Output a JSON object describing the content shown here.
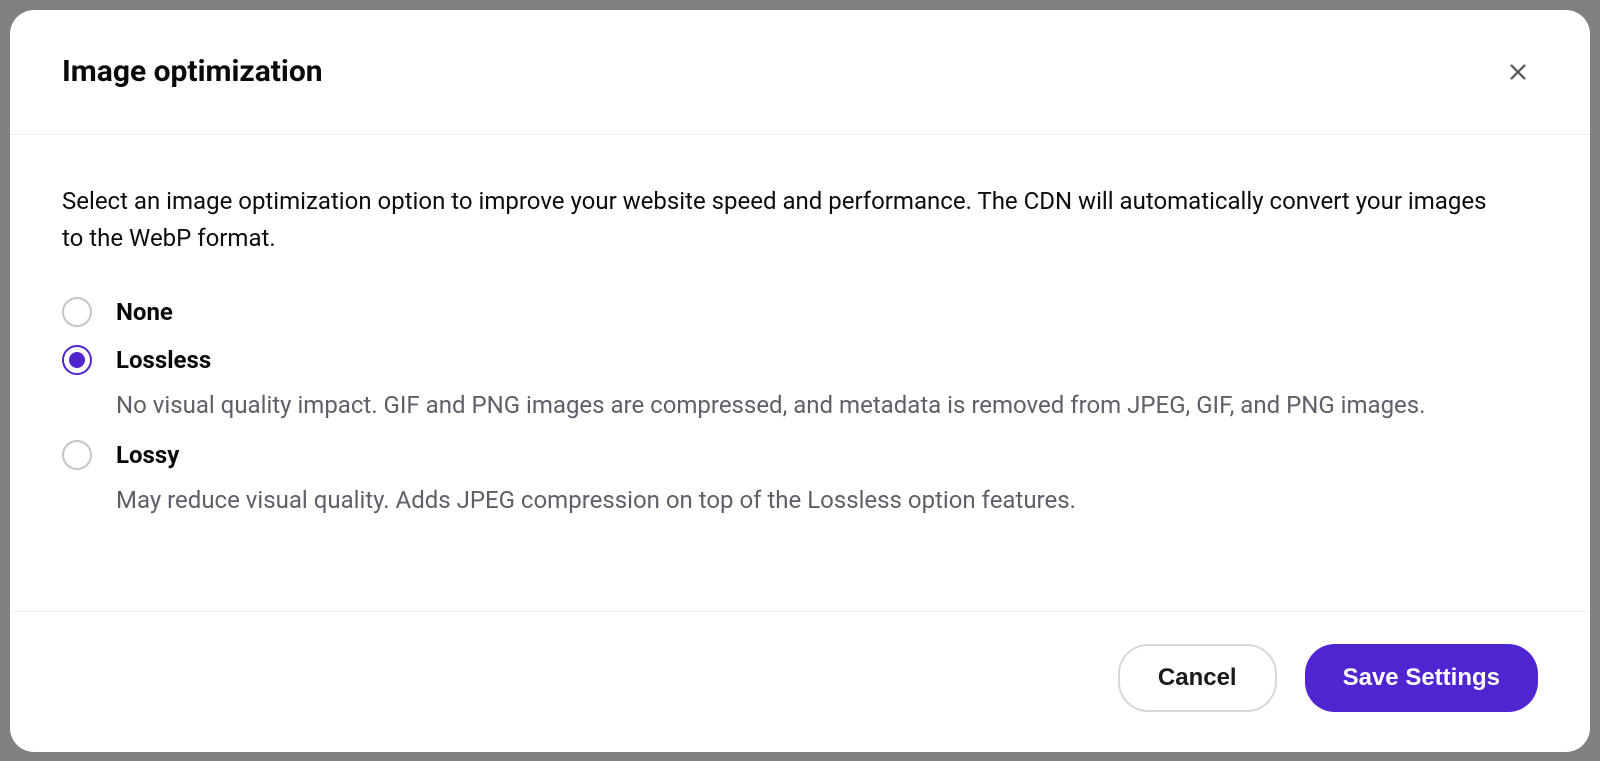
{
  "modal": {
    "title": "Image optimization",
    "description": "Select an image optimization option to improve your website speed and performance. The CDN will automatically convert your images to the WebP format.",
    "options": [
      {
        "label": "None",
        "description": "",
        "selected": false
      },
      {
        "label": "Lossless",
        "description": "No visual quality impact. GIF and PNG images are compressed, and metadata is removed from JPEG, GIF, and PNG images.",
        "selected": true
      },
      {
        "label": "Lossy",
        "description": "May reduce visual quality. Adds JPEG compression on top of the Lossless option features.",
        "selected": false
      }
    ],
    "buttons": {
      "cancel": "Cancel",
      "save": "Save Settings"
    }
  },
  "colors": {
    "accent": "#5025d1",
    "border": "#eceeef",
    "muted": "#5d6068"
  }
}
